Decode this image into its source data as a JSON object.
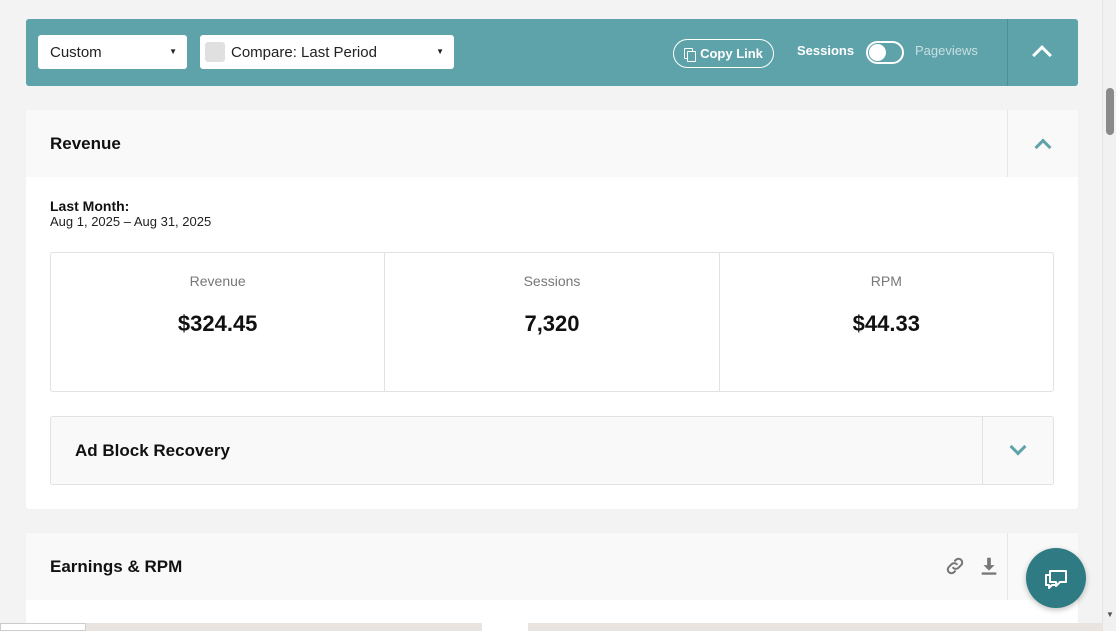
{
  "filter_bar": {
    "date_range": "Custom",
    "compare": "Compare: Last Period",
    "copy_link": "Copy Link",
    "toggle_left": "Sessions",
    "toggle_right": "Pageviews",
    "accent_color": "#5fa3aa"
  },
  "revenue_panel": {
    "title": "Revenue",
    "period_label": "Last Month:",
    "period_dates": "Aug 1, 2025 – Aug 31, 2025",
    "metrics": [
      {
        "label": "Revenue",
        "value": "$324.45"
      },
      {
        "label": "Sessions",
        "value": "7,320"
      },
      {
        "label": "RPM",
        "value": "$44.33"
      }
    ],
    "ad_block": {
      "title": "Ad Block Recovery"
    }
  },
  "earnings_panel": {
    "title": "Earnings & RPM",
    "icons": [
      "link-icon",
      "download-icon"
    ]
  },
  "chat": {
    "icon": "chat-icon",
    "color": "#2f7b83"
  }
}
